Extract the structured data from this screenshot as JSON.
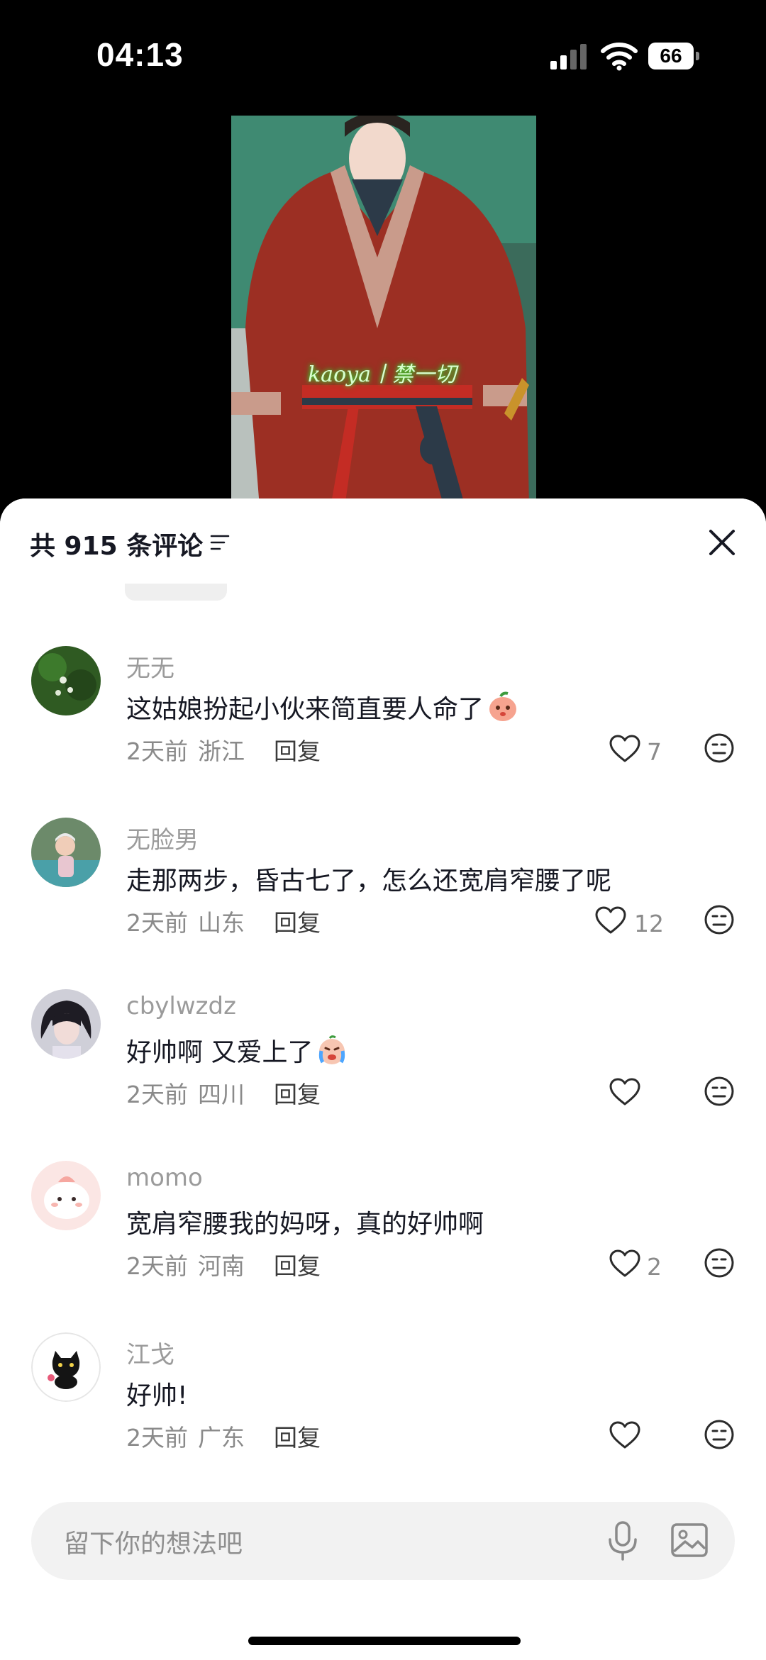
{
  "status_bar": {
    "time": "04:13",
    "battery": "66"
  },
  "video": {
    "caption": "kaoya丨禁一切"
  },
  "comments_panel": {
    "count_label": "共 915 条评论",
    "input_placeholder": "留下你的想法吧",
    "comments": [
      {
        "author": "无无",
        "text": "这姑娘扮起小伙来简直要人命了",
        "time": "2天前",
        "region": "浙江",
        "reply_label": "回复",
        "likes": "7"
      },
      {
        "author": "无脸男",
        "text": "走那两步，昏古七了，怎么还宽肩窄腰了呢",
        "time": "2天前",
        "region": "山东",
        "reply_label": "回复",
        "likes": "12"
      },
      {
        "author": "cbylwzdz",
        "text": "好帅啊 又爱上了",
        "time": "2天前",
        "region": "四川",
        "reply_label": "回复",
        "likes": ""
      },
      {
        "author": "momo",
        "text": "宽肩窄腰我的妈呀，真的好帅啊",
        "time": "2天前",
        "region": "河南",
        "reply_label": "回复",
        "likes": "2"
      },
      {
        "author": "江戈",
        "text": "好帅!",
        "time": "2天前",
        "region": "广东",
        "reply_label": "回复",
        "likes": ""
      }
    ]
  }
}
